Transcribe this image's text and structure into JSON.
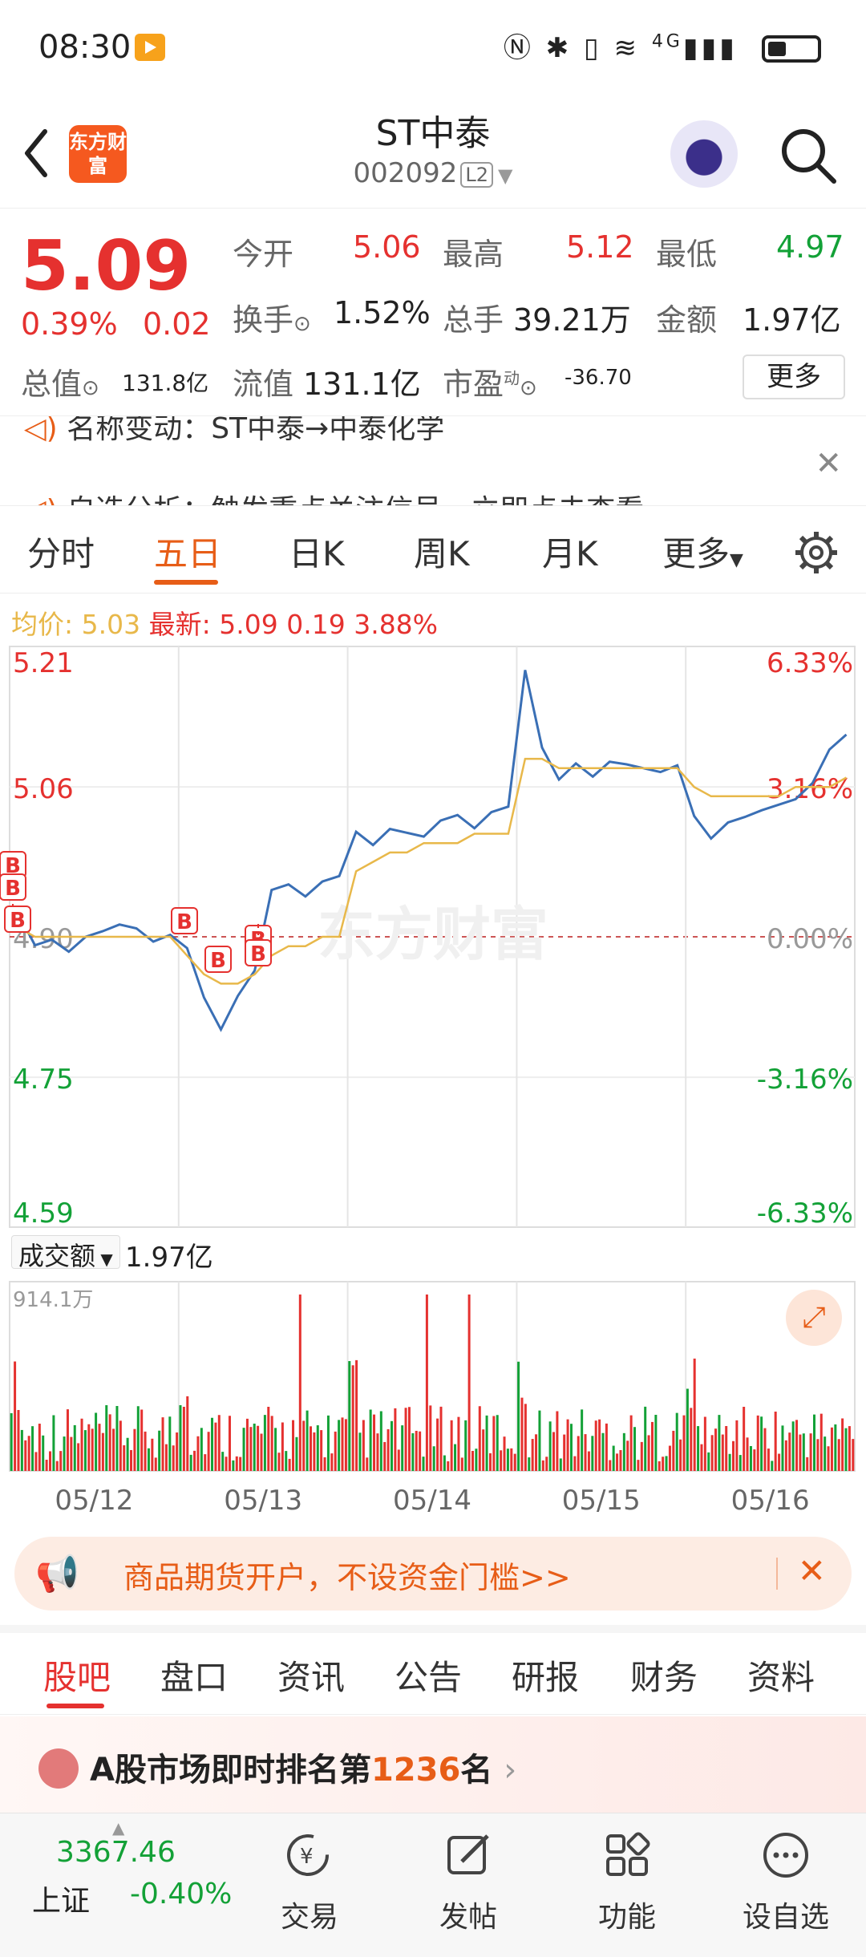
{
  "status_bar": {
    "time": "08:30",
    "network": "4G"
  },
  "header": {
    "logo_text": "东方财富",
    "title": "ST中泰",
    "code": "002092",
    "level": "L2"
  },
  "quote": {
    "price": "5.09",
    "change_pct": "0.39%",
    "change": "0.02",
    "open_label": "今开",
    "open": "5.06",
    "high_label": "最高",
    "high": "5.12",
    "low_label": "最低",
    "low": "4.97",
    "turnover_label": "换手",
    "turnover": "1.52%",
    "volume_label": "总手",
    "volume": "39.21万",
    "amount_label": "金额",
    "amount": "1.97亿",
    "mktcap_label": "总值",
    "mktcap": "131.8亿",
    "float_label": "流值",
    "float": "131.1亿",
    "pe_label": "市盈",
    "pe_sup": "动",
    "pe": "-36.70",
    "more": "更多"
  },
  "notice": {
    "line1": "名称变动：ST中泰→中泰化学",
    "line2": "自选分析：触发重点关注信号，立即点击查看"
  },
  "chart_tabs": [
    "分时",
    "五日",
    "日K",
    "周K",
    "月K",
    "更多"
  ],
  "chart_header": {
    "avg_label": "均价:",
    "avg": "5.03",
    "latest_label": "最新:",
    "latest": "5.09",
    "chg": "0.19",
    "chg_pct": "3.88%"
  },
  "chart_data": {
    "type": "line",
    "title": "五日分时",
    "x": [
      "05/12",
      "05/13",
      "05/14",
      "05/15",
      "05/16"
    ],
    "y_left_ticks": [
      "5.21",
      "5.06",
      "4.90",
      "4.75",
      "4.59"
    ],
    "y_right_ticks": [
      "6.33%",
      "3.16%",
      "0.00%",
      "-3.16%",
      "-6.33%"
    ],
    "ylim": [
      4.59,
      5.21
    ],
    "prev_close": 4.9,
    "series": [
      {
        "name": "价格",
        "color": "#3a6fb5",
        "values": [
          4.92,
          4.89,
          4.9,
          4.88,
          4.9,
          4.91,
          4.91,
          4.91,
          4.9,
          4.9,
          4.89,
          4.83,
          4.8,
          4.84,
          4.86,
          4.95,
          4.96,
          4.94,
          4.96,
          4.97,
          5.01,
          5.0,
          5.01,
          5.01,
          5.01,
          5.02,
          5.03,
          5.02,
          5.03,
          5.04,
          5.19,
          5.1,
          5.07,
          5.08,
          5.07,
          5.09,
          5.08,
          5.08,
          5.08,
          5.08,
          5.03,
          5.01,
          5.02,
          5.03,
          5.03,
          5.04,
          5.05,
          5.06,
          5.1,
          5.12
        ]
      },
      {
        "name": "均价",
        "color": "#e8b84a",
        "values": [
          4.91,
          4.9,
          4.9,
          4.9,
          4.9,
          4.9,
          4.9,
          4.9,
          4.9,
          4.9,
          4.88,
          4.86,
          4.85,
          4.85,
          4.86,
          4.88,
          4.89,
          4.89,
          4.9,
          4.9,
          4.97,
          4.98,
          4.99,
          4.99,
          5.0,
          5.0,
          5.0,
          5.01,
          5.01,
          5.01,
          5.09,
          5.09,
          5.08,
          5.08,
          5.08,
          5.08,
          5.08,
          5.08,
          5.08,
          5.08,
          5.06,
          5.05,
          5.05,
          5.05,
          5.05,
          5.05,
          5.06,
          5.06,
          5.06,
          5.07
        ]
      }
    ],
    "buy_markers": [
      {
        "day": 0,
        "label": "B"
      },
      {
        "day": 0,
        "label": "B"
      },
      {
        "day": 0,
        "label": "B"
      },
      {
        "day": 1,
        "label": "B"
      },
      {
        "day": 1,
        "label": "B"
      },
      {
        "day": 1,
        "label": "B"
      },
      {
        "day": 1,
        "label": "B"
      }
    ],
    "volume": {
      "label": "成交额",
      "total": "1.97亿",
      "max_label": "914.1万"
    }
  },
  "banner": {
    "text": "商品期货开户，不设资金门槛>>"
  },
  "bottom_tabs": [
    "股吧",
    "盘口",
    "资讯",
    "公告",
    "研报",
    "财务",
    "资料"
  ],
  "rank": {
    "prefix": "A股市场即时排名第",
    "rank": "1236",
    "suffix": "名"
  },
  "bottom_nav": {
    "index_value": "3367.46",
    "index_name": "上证",
    "index_change": "-0.40%",
    "items": [
      "交易",
      "发帖",
      "功能",
      "设自选"
    ]
  },
  "colors": {
    "up": "#e5312f",
    "down": "#13a137",
    "accent": "#e75d17",
    "price_line": "#3a6fb5",
    "avg_line": "#e8b84a"
  }
}
